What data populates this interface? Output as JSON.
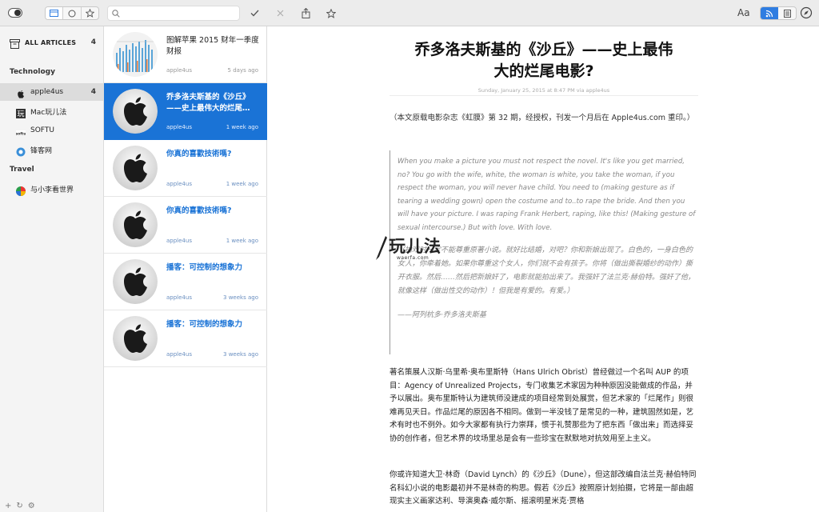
{
  "toolbar": {
    "search_placeholder": "",
    "font_label": "Aa"
  },
  "sidebar": {
    "all_articles": {
      "label": "ALL ARTICLES",
      "count": "4"
    },
    "groups": [
      {
        "name": "Technology"
      },
      {
        "name": "Travel"
      }
    ],
    "items": [
      {
        "label": "apple4us",
        "count": "4"
      },
      {
        "label": "Mac玩儿法",
        "count": ""
      },
      {
        "label": "SOFTU",
        "count": ""
      },
      {
        "label": "锋客网",
        "count": ""
      },
      {
        "label": "与小李看世界",
        "count": ""
      }
    ]
  },
  "articles": [
    {
      "title": "图解苹果 2015 财年一季度财报",
      "feed": "apple4us",
      "time": "5 days ago"
    },
    {
      "title": "乔多洛夫斯基的《沙丘》——史上最伟大的烂尾…",
      "feed": "apple4us",
      "time": "1 week ago"
    },
    {
      "title": "你真的喜歡技術嗎?",
      "feed": "apple4us",
      "time": "1 week ago"
    },
    {
      "title": "你真的喜歡技術嗎?",
      "feed": "apple4us",
      "time": "1 week ago"
    },
    {
      "title": "播客：可控制的想象力",
      "feed": "apple4us",
      "time": "3 weeks ago"
    },
    {
      "title": "播客：可控制的想象力",
      "feed": "apple4us",
      "time": "3 weeks ago"
    }
  ],
  "reader": {
    "title_line1": "乔多洛夫斯基的《沙丘》——史上最伟",
    "title_line2": "大的烂尾电影?",
    "meta": "Sunday, January 25, 2015 at 8:47 PM via apple4us",
    "intro": "（本文原载电影杂志《虹膜》第 32 期，经授权，刊发一个月后在 Apple4us.com 重印。）",
    "quote_en": "When you make a picture you must not respect the novel. It's like you get married, no? You go with the wife, white, the woman is white, you take the woman, if you respect the woman, you will never have child. You need to (making gesture as if tearing a wedding gown) open the costume and to..to rape the bride. And then you will have your picture. I was raping Frank Herbert, raping, like this! (Making gesture of sexual intercourse.) But with love. With love.",
    "quote_zh": "（拍戏时一定不能尊重原著小说。就好比结婚，对吧？你和新娘出现了。白色的，一身白色的女人，你牵着她。如果你尊重这个女人，你们就不会有孩子。你将（做出撕裂婚纱的动作）撕开衣服。然后……然后把新娘奸了，电影就能拍出来了。我强奸了法兰克·赫伯特。强奸了他，就像这样（做出性交的动作）！但我是有爱的。有爱。）",
    "quote_src": "——阿列杭多·乔多洛夫斯基",
    "p1": "著名策展人汉斯·乌里希·奥布里斯特（Hans Ulrich Obrist）曾经做过一个名叫 AUP 的项目：Agency of Unrealized Projects，专门收集艺术家因为种种原因没能做成的作品，并予以展出。奥布里斯特认为建筑师没建成的项目经常到处展赏，但艺术家的「烂尾作」则很难再见天日。作品烂尾的原因各不相同。做到一半没钱了是常见的一种，建筑固然如是，艺术有时也不例外。如今大家都有执行力崇拜，惯于礼赞那些为了把东西「做出来」而选择妥协的创作者，但艺术界的坟场里总是会有一些珍宝在默默地对抗效用至上主义。",
    "p2": "你或许知道大卫·林奇（David Lynch）的《沙丘》（Dune），但这部改编自法兰克·赫伯特同名科幻小说的电影最初并不是林奇的构思。假若《沙丘》按照原计划拍摄，它将是一部由超现实主义画家达利、导演奥森·威尔斯、摇滚明星米克·贾格"
  },
  "watermark": {
    "main": "玩儿法",
    "sub": "waerfa.com"
  },
  "colors": {
    "accent": "#1a73d6",
    "sidebar_bg": "#f4f4f4",
    "toolbar_bg": "#ececec"
  }
}
